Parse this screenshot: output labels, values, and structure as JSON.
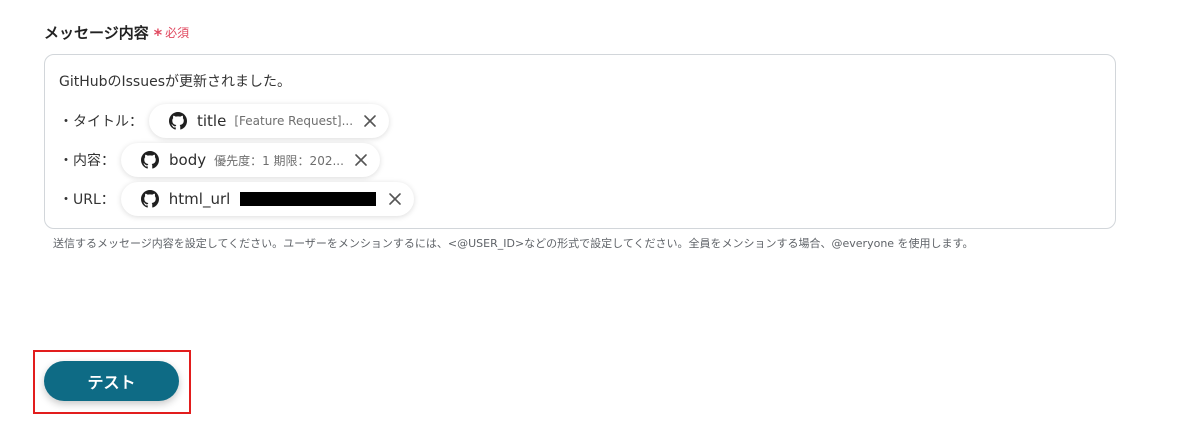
{
  "field": {
    "label": "メッセージ内容",
    "required_mark": "*",
    "required_text": "必須"
  },
  "message": {
    "intro": "GitHubのIssuesが更新されました。",
    "lines": [
      {
        "prefix": "・タイトル：",
        "chip": {
          "icon": "github-icon",
          "name": "title",
          "preview": "[Feature Request]..."
        }
      },
      {
        "prefix": "・内容：",
        "chip": {
          "icon": "github-icon",
          "name": "body",
          "preview": "優先度：1 期限：202..."
        }
      },
      {
        "prefix": "・URL：",
        "chip": {
          "icon": "github-icon",
          "name": "html_url",
          "preview_redacted": true
        }
      }
    ]
  },
  "helper_text": "送信するメッセージ内容を設定してください。ユーザーをメンションするには、<@USER_ID>などの形式で設定してください。全員をメンションする場合、@everyone を使用します。",
  "actions": {
    "test_label": "テスト"
  },
  "colors": {
    "required": "#e0485f",
    "button": "#0e6b85",
    "highlight": "#e21d1d"
  }
}
